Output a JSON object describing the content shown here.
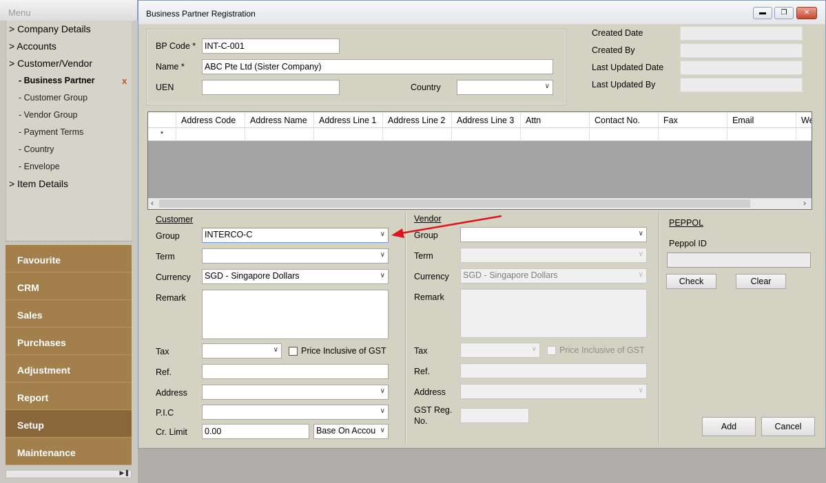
{
  "menu": {
    "header": "Menu",
    "tree": [
      "> Company Details",
      "> Accounts",
      "> Customer/Vendor",
      "> Item Details"
    ],
    "sub_items": [
      "- Business Partner",
      "- Customer Group",
      "- Vendor Group",
      "- Payment Terms",
      "- Country",
      "- Envelope"
    ],
    "close_mark": "x",
    "modules": [
      "Favourite",
      "CRM",
      "Sales",
      "Purchases",
      "Adjustment",
      "Report",
      "Setup",
      "Maintenance"
    ],
    "active_module": "Setup"
  },
  "window": {
    "title": "Business Partner Registration"
  },
  "header_form": {
    "bp_code_label": "BP Code *",
    "bp_code_value": "INT-C-001",
    "name_label": "Name *",
    "name_value": "ABC Pte Ltd (Sister Company)",
    "uen_label": "UEN",
    "uen_value": "",
    "country_label": "Country",
    "country_value": ""
  },
  "audit": {
    "created_date_label": "Created Date",
    "created_by_label": "Created By",
    "last_updated_date_label": "Last Updated Date",
    "last_updated_by_label": "Last Updated By"
  },
  "address_grid": {
    "columns": [
      "Address Code",
      "Address Name",
      "Address Line 1",
      "Address Line 2",
      "Address Line 3",
      "Attn",
      "Contact No.",
      "Fax",
      "Email",
      "We"
    ],
    "new_row_marker": "*"
  },
  "customer": {
    "title": "Customer",
    "group_label": "Group",
    "group_value": "INTERCO-C",
    "term_label": "Term",
    "term_value": "",
    "currency_label": "Currency",
    "currency_value": "SGD - Singapore Dollars",
    "remark_label": "Remark",
    "remark_value": "",
    "tax_label": "Tax",
    "tax_value": "",
    "price_incl_label": "Price Inclusive of GST",
    "ref_label": "Ref.",
    "address_label": "Address",
    "pic_label": "P.I.C",
    "cr_limit_label": "Cr. Limit",
    "cr_limit_value": "0.00",
    "cr_basis_value": "Base On Accou"
  },
  "vendor": {
    "title": "Vendor",
    "group_label": "Group",
    "group_value": "",
    "term_label": "Term",
    "currency_label": "Currency",
    "currency_value": "SGD - Singapore Dollars",
    "remark_label": "Remark",
    "tax_label": "Tax",
    "price_incl_label": "Price Inclusive of GST",
    "ref_label": "Ref.",
    "address_label": "Address",
    "gst_reg_label_1": "GST Reg.",
    "gst_reg_label_2": "No."
  },
  "peppol": {
    "title": "PEPPOL",
    "id_label": "Peppol ID",
    "id_value": "",
    "check_label": "Check",
    "clear_label": "Clear"
  },
  "actions": {
    "add_label": "Add",
    "cancel_label": "Cancel"
  },
  "annotation_color": "#e0141e"
}
